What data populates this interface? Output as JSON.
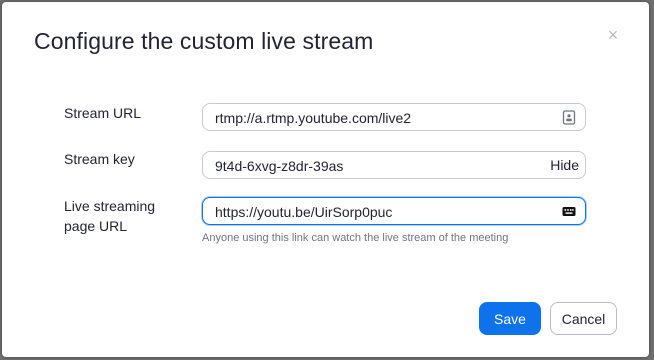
{
  "dialog": {
    "title": "Configure the custom live stream",
    "close_glyph": "×"
  },
  "fields": {
    "stream_url": {
      "label": "Stream URL",
      "value": "rtmp://a.rtmp.youtube.com/live2",
      "icon": "contact-card-icon"
    },
    "stream_key": {
      "label": "Stream key",
      "value": "9t4d-6xvg-z8dr-39as",
      "toggle_label": "Hide"
    },
    "page_url": {
      "label_line1": "Live streaming",
      "label_line2": "page URL",
      "value": "https://youtu.be/UirSorp0puc",
      "icon": "keyboard-icon",
      "hint": "Anyone using this link can watch the live stream of the meeting"
    }
  },
  "buttons": {
    "save_label": "Save",
    "cancel_label": "Cancel"
  },
  "colors": {
    "primary": "#0e72ed",
    "text": "#232333",
    "backdrop": "#6e6e6e"
  }
}
